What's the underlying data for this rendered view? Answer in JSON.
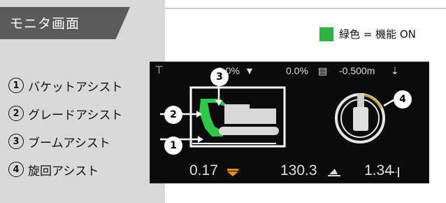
{
  "panel": {
    "title": "モニタ画面",
    "features": [
      {
        "num": "1",
        "label": "バケットアシスト"
      },
      {
        "num": "2",
        "label": "グレードアシスト"
      },
      {
        "num": "3",
        "label": "ブームアシスト"
      },
      {
        "num": "4",
        "label": "旋回アシスト"
      }
    ]
  },
  "legend": {
    "text": "緑色 = 機能 ON",
    "color": "#33b044"
  },
  "monitor": {
    "status": {
      "slope_value": "0.0%",
      "cross_value": "0.0%",
      "depth_value": "-0.500m"
    },
    "bottom": {
      "left_value": "0.17",
      "mid_value": "130.3",
      "right_value": "1.34"
    },
    "callouts": [
      "1",
      "2",
      "3",
      "4"
    ]
  }
}
